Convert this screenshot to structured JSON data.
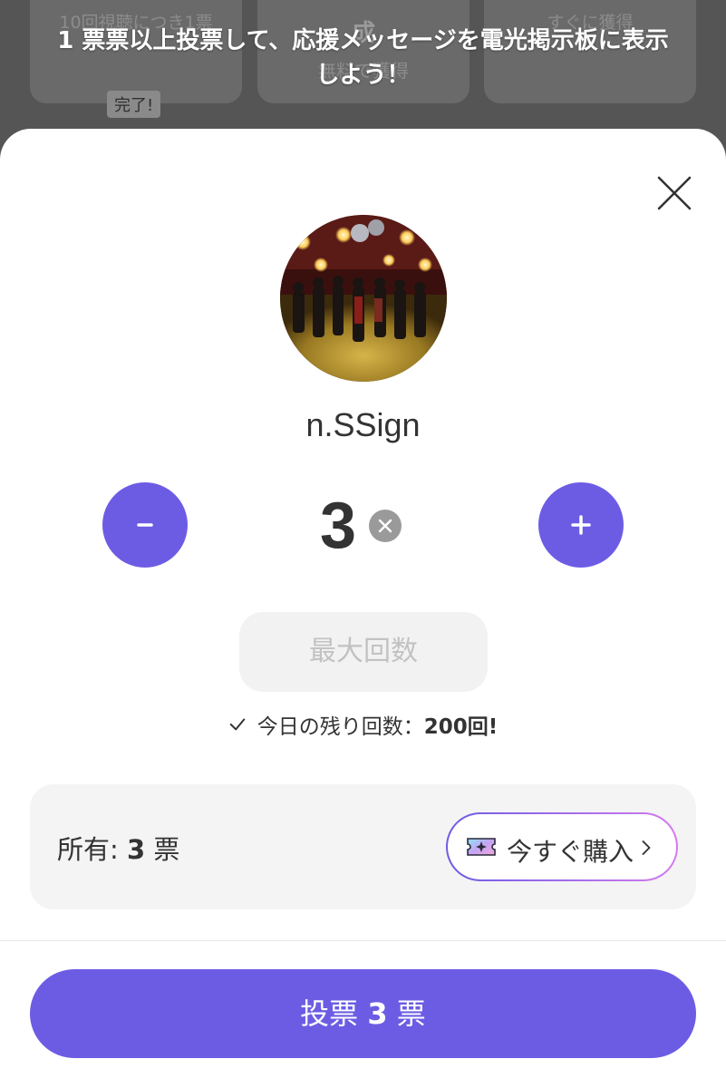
{
  "background": {
    "card_1_line1": "10回視聴につき1票",
    "card_1_badge": "完了!",
    "card_2_big": "成",
    "card_2_line2": "無料で獲得",
    "card_3_line1": "すぐに獲得"
  },
  "toast": {
    "line_1": "1 票票以上投票して、応援メッセージを電光掲示板に表示",
    "line_2": "しよう！"
  },
  "sheet": {
    "close_icon": "close-icon",
    "artist_name": "n.SSign",
    "vote_count": "3",
    "max_button_label": "最大回数",
    "remaining_label": "今日の残り回数：",
    "remaining_count": "200回!",
    "owned_label": "所有:",
    "owned_count": "3",
    "owned_unit": "票",
    "buy_button_label": "今すぐ購入",
    "vote_button_prefix": "投票",
    "vote_button_count": "3",
    "vote_button_unit": "票"
  },
  "colors": {
    "accent": "#6c5ce4",
    "gradient_end": "#d57bf0",
    "disabled_text": "#c2c2c2",
    "text_primary": "#333333"
  }
}
